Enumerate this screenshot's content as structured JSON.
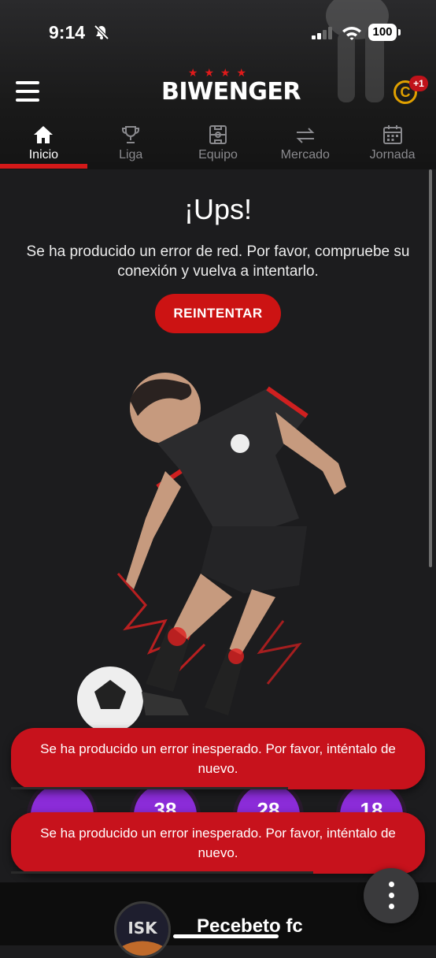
{
  "status_bar": {
    "time": "9:14",
    "battery": "100"
  },
  "header": {
    "logo": "BIWENGER",
    "coin_badge": "+1",
    "coin_symbol": "C"
  },
  "tabs": [
    {
      "label": "Inicio",
      "icon": "home-icon",
      "active": true
    },
    {
      "label": "Liga",
      "icon": "trophy-icon",
      "active": false
    },
    {
      "label": "Equipo",
      "icon": "pitch-icon",
      "active": false
    },
    {
      "label": "Mercado",
      "icon": "transfer-arrows-icon",
      "active": false
    },
    {
      "label": "Jornada",
      "icon": "calendar-icon",
      "active": false
    }
  ],
  "error": {
    "title": "¡Ups!",
    "message": "Se ha producido un error de red. Por favor, compruebe su conexión y vuelva a intentarlo.",
    "retry_label": "REINTENTAR"
  },
  "bubbles": [
    "",
    "38",
    "28",
    "18"
  ],
  "toasts": [
    {
      "text": "Se ha producido un error inesperado. Por favor, inténtalo de nuevo.",
      "progress": 0.67
    },
    {
      "text": "Se ha producido un error inesperado. Por favor, inténtalo de nuevo.",
      "progress": 0.73
    }
  ],
  "bottom": {
    "team_name": "Pecebeto fc",
    "avatar_text": "ISK"
  },
  "colors": {
    "accent": "#cc1313",
    "background": "#1c1c1e",
    "coin": "#e0a000",
    "bubble": "#8b2cd8"
  }
}
